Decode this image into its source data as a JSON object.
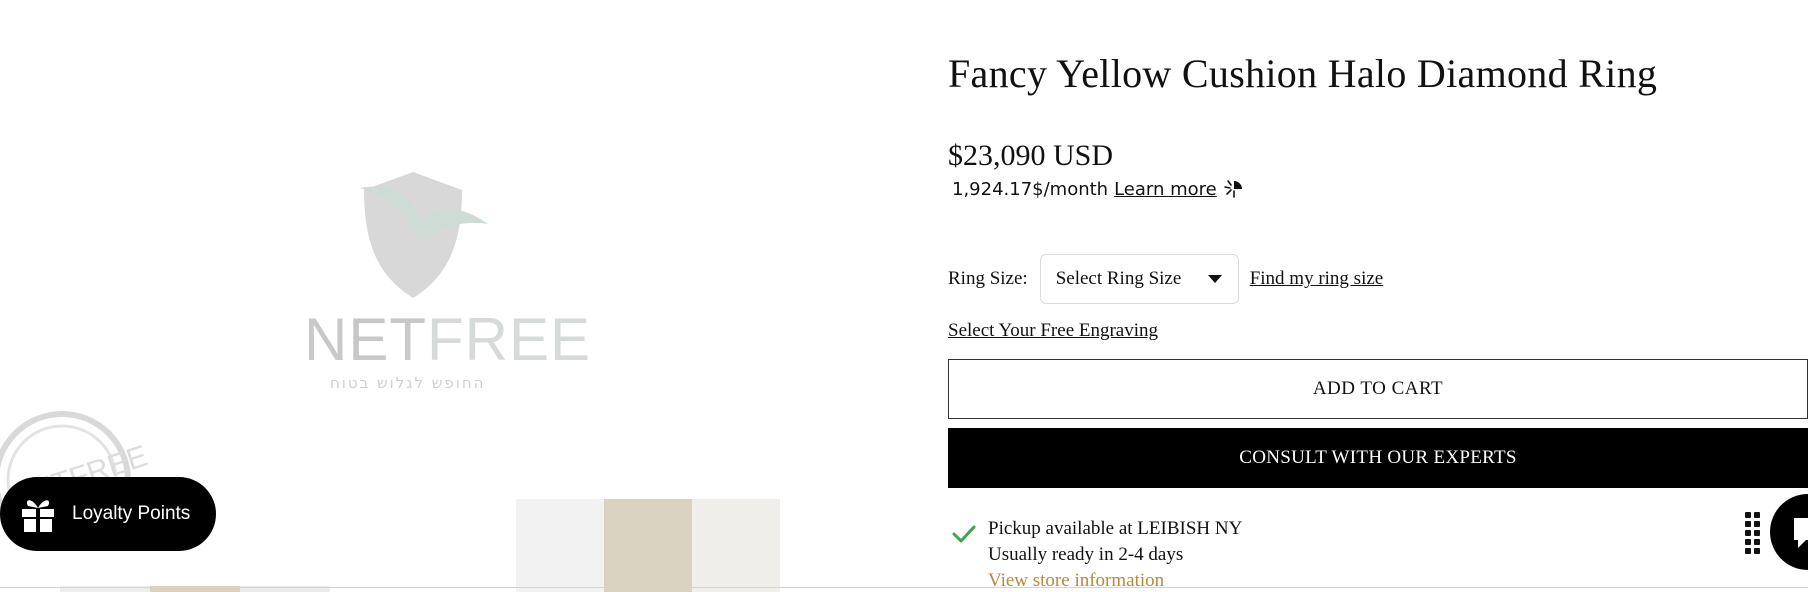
{
  "media": {
    "logo_text_a": "NET",
    "logo_text_b": "FREE",
    "logo_tagline": "החופש לגלוש בטוח",
    "logo_icon": "netfree-shield-icon",
    "stamp_icon": "netfree-stamp-icon"
  },
  "loyalty": {
    "label": "Loyalty Points",
    "icon": "gift-icon"
  },
  "product": {
    "title": "Fancy Yellow Cushion Halo Diamond Ring",
    "price": "$23,090 USD",
    "installment_amount": "1,924.17$/month",
    "learn_more": "Learn more",
    "ring_size_label": "Ring Size:",
    "ring_size_selected": "Select Ring Size",
    "find_size_link": "Find my ring size",
    "engraving_link": "Select Your Free Engraving",
    "add_to_cart": "ADD TO CART",
    "consult": "CONSULT WITH OUR EXPERTS"
  },
  "pickup": {
    "available": "Pickup available at LEIBISH NY",
    "ready": "Usually ready in 2-4 days",
    "store_link": "View store information"
  },
  "colors": {
    "accent_link": "#b6893e",
    "check": "#3aa845",
    "button_dark": "#000000"
  }
}
